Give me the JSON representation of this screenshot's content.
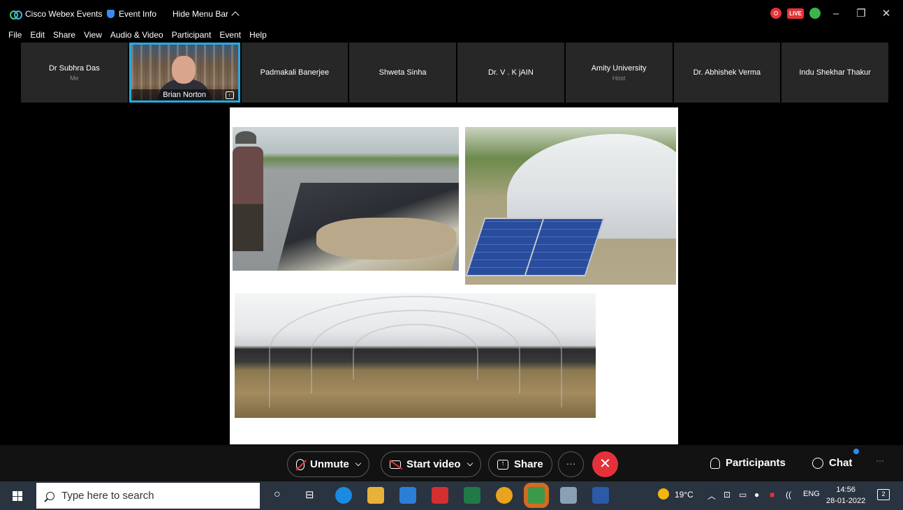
{
  "titlebar": {
    "app_name": "Cisco Webex Events",
    "event_info": "Event Info",
    "hide_menu": "Hide Menu Bar",
    "live_badge": "LIVE"
  },
  "menu": [
    "File",
    "Edit",
    "Share",
    "View",
    "Audio & Video",
    "Participant",
    "Event",
    "Help"
  ],
  "participants": [
    {
      "name": "Dr Subhra Das",
      "role": "Me"
    },
    {
      "name": "Brian Norton",
      "role": "",
      "video": true
    },
    {
      "name": "Padmakali Banerjee",
      "role": ""
    },
    {
      "name": "Shweta Sinha",
      "role": ""
    },
    {
      "name": "Dr. V . K jAIN",
      "role": ""
    },
    {
      "name": "Amity University",
      "role": "Host"
    },
    {
      "name": "Dr. Abhishek Verma",
      "role": ""
    },
    {
      "name": "Indu Shekhar Thakur",
      "role": ""
    }
  ],
  "controls": {
    "unmute": "Unmute",
    "start_video": "Start video",
    "share": "Share",
    "more": "···",
    "end": "✕",
    "participants": "Participants",
    "chat": "Chat",
    "overflow": "···"
  },
  "taskbar": {
    "search_placeholder": "Type here to search",
    "weather": "19°C",
    "language": "ENG",
    "time": "14:56",
    "date": "28-01-2022",
    "notifications": "2"
  },
  "colors": {
    "accent_blue": "#28a9e0",
    "end_red": "#e5323a",
    "control_bar": "#121212",
    "tile_bg": "#272727"
  }
}
